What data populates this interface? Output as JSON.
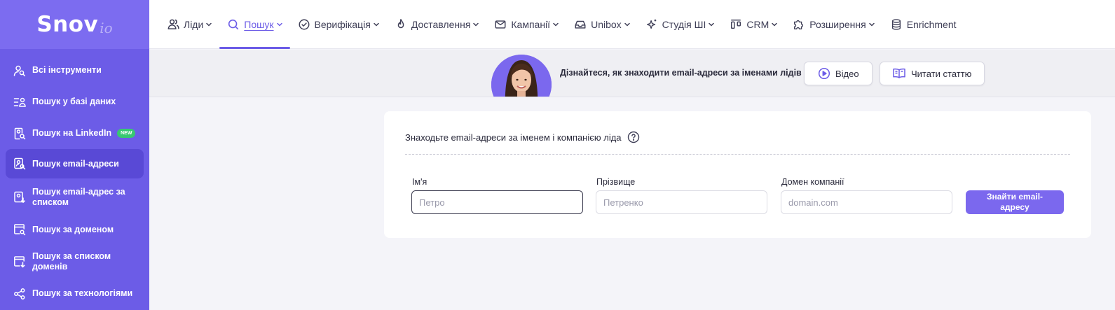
{
  "brand": {
    "name": "Snov",
    "suffix": "io"
  },
  "colors": {
    "accent": "#6c5ce7",
    "sidebar": "#6c5ce7",
    "new_badge": "#37c871"
  },
  "sidebar": {
    "items": [
      {
        "label": "Всі інструменти",
        "icon": "user-search-icon"
      },
      {
        "label": "Пошук у базі даних",
        "icon": "list-user-icon"
      },
      {
        "label": "Пошук на LinkedIn",
        "icon": "document-search-icon",
        "badge": "NEW"
      },
      {
        "label": "Пошук email-адреси",
        "icon": "contact-search-icon",
        "active": true
      },
      {
        "label": "Пошук email-адрес за списком",
        "icon": "contact-upload-icon"
      },
      {
        "label": "Пошук за доменом",
        "icon": "browser-search-icon"
      },
      {
        "label": "Пошук за списком доменів",
        "icon": "browser-upload-icon"
      },
      {
        "label": "Пошук за технологіями",
        "icon": "share-nodes-icon"
      }
    ]
  },
  "topnav": {
    "items": [
      {
        "label": "Ліди",
        "icon": "users-icon"
      },
      {
        "label": "Пошук",
        "icon": "search-icon",
        "active": true
      },
      {
        "label": "Верифікація",
        "icon": "check-circle-icon"
      },
      {
        "label": "Доставлення",
        "icon": "flame-icon"
      },
      {
        "label": "Кампанії",
        "icon": "mail-icon"
      },
      {
        "label": "Unibox",
        "icon": "inbox-icon"
      },
      {
        "label": "Студія ШІ",
        "icon": "sparkles-icon"
      },
      {
        "label": "CRM",
        "icon": "kanban-icon"
      },
      {
        "label": "Розширення",
        "icon": "puzzle-icon"
      },
      {
        "label": "Enrichment",
        "icon": "database-icon"
      }
    ]
  },
  "banner": {
    "text": "Дізнайтеся, як знаходити email-адреси за іменами лідів",
    "video_label": "Відео",
    "article_label": "Читати статтю"
  },
  "form": {
    "title": "Знаходьте email-адреси за іменем і компанією ліда",
    "first_name": {
      "label": "Ім'я",
      "placeholder": "Петро",
      "value": ""
    },
    "last_name": {
      "label": "Прізвище",
      "placeholder": "Петренко",
      "value": ""
    },
    "domain": {
      "label": "Домен компанії",
      "placeholder": "domain.com",
      "value": ""
    },
    "submit_label": "Знайти email-адресу"
  }
}
